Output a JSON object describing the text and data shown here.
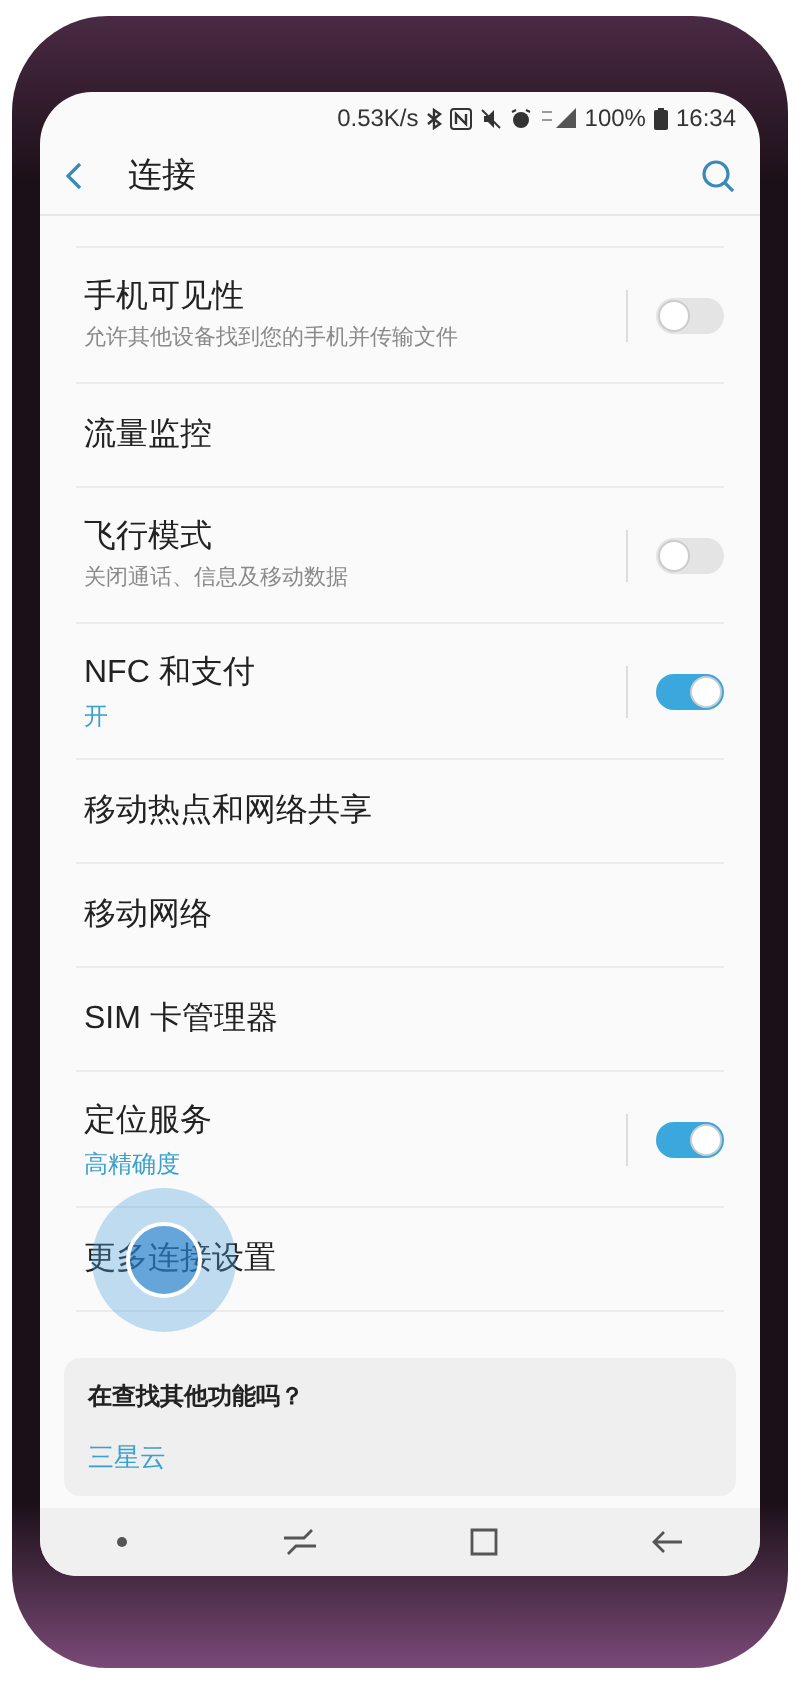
{
  "status_bar": {
    "speed": "0.53K/s",
    "battery": "100%",
    "time": "16:34"
  },
  "header": {
    "title": "连接"
  },
  "items": [
    {
      "kind": "switch",
      "title": "手机可见性",
      "subtitle": "允许其他设备找到您的手机并传输文件",
      "subtitle_accent": false,
      "on": false
    },
    {
      "kind": "plain",
      "title": "流量监控"
    },
    {
      "kind": "switch",
      "title": "飞行模式",
      "subtitle": "关闭通话、信息及移动数据",
      "subtitle_accent": false,
      "on": false
    },
    {
      "kind": "switch",
      "title": "NFC 和支付",
      "subtitle": "开",
      "subtitle_accent": true,
      "on": true
    },
    {
      "kind": "plain",
      "title": "移动热点和网络共享"
    },
    {
      "kind": "plain",
      "title": "移动网络"
    },
    {
      "kind": "plain",
      "title": "SIM 卡管理器"
    },
    {
      "kind": "switch",
      "title": "定位服务",
      "subtitle": "高精确度",
      "subtitle_accent": true,
      "on": true
    },
    {
      "kind": "plain",
      "title": "更多连接设置",
      "touched": true
    }
  ],
  "suggestion": {
    "title": "在查找其他功能吗？",
    "link": "三星云"
  }
}
